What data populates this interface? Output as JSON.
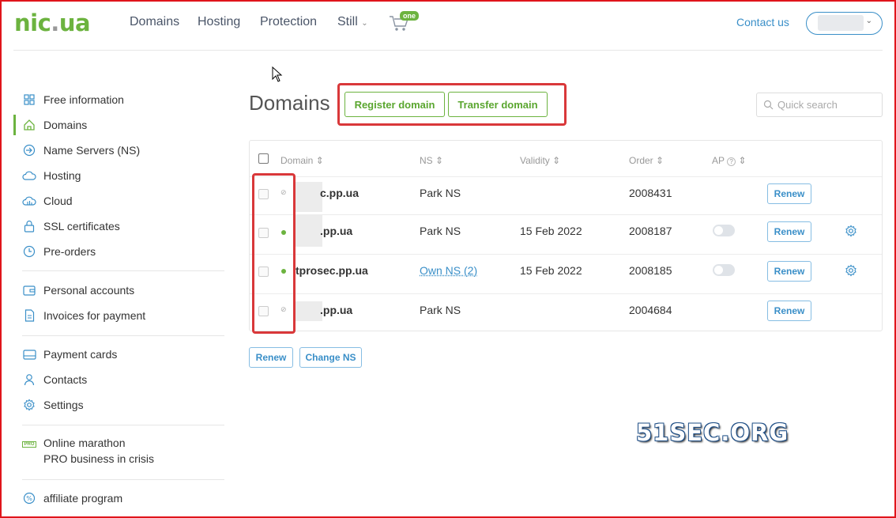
{
  "header": {
    "logo_main": "nic",
    "logo_dot": ".",
    "logo_tld": "ua",
    "nav": [
      "Domains",
      "Hosting",
      "Protection",
      "Still"
    ],
    "cart_badge": "one",
    "contact": "Contact us"
  },
  "sidebar": {
    "group1": [
      {
        "label": "Free information",
        "icon": "grid-icon"
      },
      {
        "label": "Domains",
        "icon": "home-icon",
        "active": true
      },
      {
        "label": "Name Servers (NS)",
        "icon": "arrow-circle-icon"
      },
      {
        "label": "Hosting",
        "icon": "cloud-icon"
      },
      {
        "label": "Cloud",
        "icon": "cloud-server-icon"
      },
      {
        "label": "SSL certificates",
        "icon": "lock-icon"
      },
      {
        "label": "Pre-orders",
        "icon": "clock-icon"
      }
    ],
    "group2": [
      {
        "label": "Personal accounts",
        "icon": "wallet-icon"
      },
      {
        "label": "Invoices for payment",
        "icon": "document-icon"
      }
    ],
    "group3": [
      {
        "label": "Payment cards",
        "icon": "card-icon"
      },
      {
        "label": "Contacts",
        "icon": "person-icon"
      },
      {
        "label": "Settings",
        "icon": "gear-icon"
      }
    ],
    "pro_badge": "PRO",
    "marathon_line1": "Online marathon",
    "marathon_line2": "PRO business in crisis",
    "affiliate": "affiliate program"
  },
  "main": {
    "title": "Domains",
    "register_label": "Register domain",
    "transfer_label": "Transfer domain",
    "search_placeholder": "Quick search",
    "columns": {
      "domain": "Domain",
      "ns": "NS",
      "validity": "Validity",
      "order": "Order",
      "ap": "AP"
    },
    "rows": [
      {
        "status": "inactive",
        "domain": "c.pp.ua",
        "ns": "Park NS",
        "validity": "",
        "order": "2008431",
        "renew": "Renew"
      },
      {
        "status": "active",
        "domain": ".pp.ua",
        "ns": "Park NS",
        "validity": "15 Feb 2022",
        "order": "2008187",
        "renew": "Renew"
      },
      {
        "status": "active",
        "domain": "tprosec.pp.ua",
        "ns": "Own NS (2)",
        "validity": "15 Feb 2022",
        "order": "2008185",
        "renew": "Renew"
      },
      {
        "status": "inactive",
        "domain": ".pp.ua",
        "ns": "Park NS",
        "validity": "",
        "order": "2004684",
        "renew": "Renew"
      }
    ],
    "bulk_renew": "Renew",
    "bulk_change_ns": "Change NS"
  },
  "watermark": "51SEC.ORG",
  "colors": {
    "brand_green": "#6cb33f",
    "link_blue": "#3a8fc8",
    "highlight_red": "#d9383a"
  }
}
